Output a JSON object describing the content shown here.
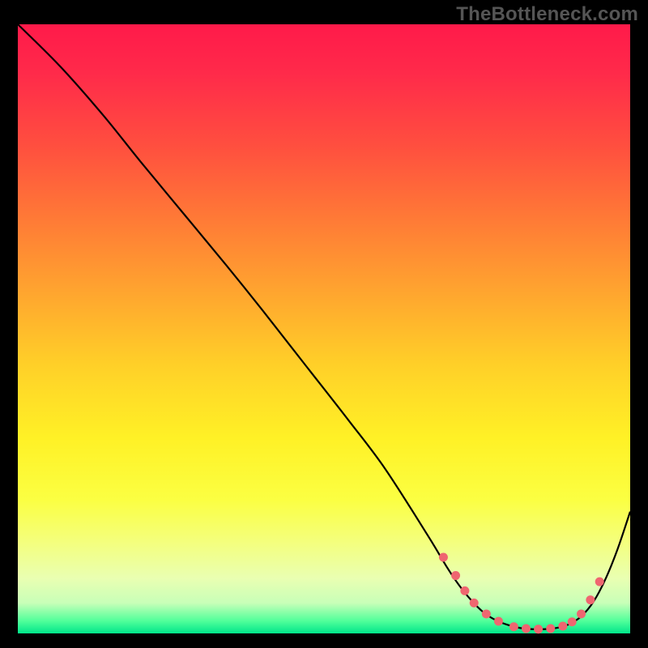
{
  "watermark": "TheBottleneck.com",
  "chart_data": {
    "type": "line",
    "title": "",
    "xlabel": "",
    "ylabel": "",
    "xlim": [
      0,
      100
    ],
    "ylim": [
      0,
      100
    ],
    "series": [
      {
        "name": "curve",
        "x": [
          0,
          7,
          14,
          20,
          27,
          34,
          40,
          47,
          54,
          60,
          67,
          70,
          72,
          74,
          76,
          78,
          80,
          82,
          84,
          86,
          88,
          90,
          92,
          94,
          96,
          98,
          100
        ],
        "y": [
          100,
          93,
          85,
          77.5,
          69,
          60.5,
          53,
          44,
          35,
          27,
          16,
          11,
          8,
          5.5,
          3.5,
          2.2,
          1.4,
          0.9,
          0.7,
          0.7,
          0.9,
          1.5,
          2.8,
          5.2,
          9,
          14,
          20
        ]
      }
    ],
    "markers": {
      "x": [
        69.5,
        71.5,
        73,
        74.5,
        76.5,
        78.5,
        81,
        83,
        85,
        87,
        89,
        90.5,
        92,
        93.5,
        95
      ],
      "y": [
        12.5,
        9.5,
        7,
        5,
        3.2,
        2,
        1.1,
        0.8,
        0.7,
        0.8,
        1.2,
        1.9,
        3.2,
        5.5,
        8.5
      ]
    }
  },
  "colors": {
    "curve": "#000000",
    "marker": "#ef6670"
  }
}
